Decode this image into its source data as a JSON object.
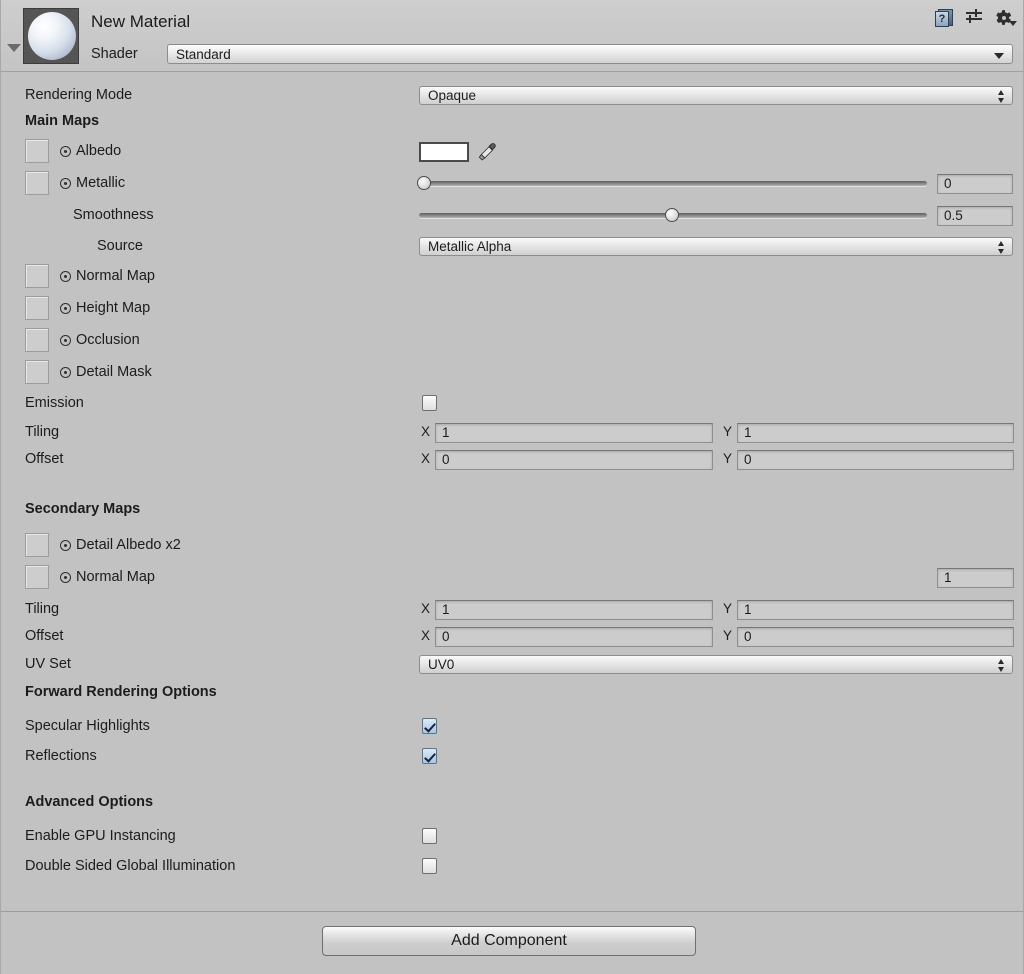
{
  "header": {
    "material_name": "New Material",
    "shader_label": "Shader",
    "shader_value": "Standard",
    "icons": {
      "help": "help-book-icon",
      "help_glyph": "?",
      "preset": "preset-sliders-icon",
      "settings": "gear-icon"
    }
  },
  "rendering_mode": {
    "label": "Rendering Mode",
    "value": "Opaque"
  },
  "main_maps": {
    "title": "Main Maps",
    "albedo": {
      "label": "Albedo",
      "color": "#ffffff"
    },
    "metallic": {
      "label": "Metallic",
      "value": "0",
      "slider": 0
    },
    "smoothness": {
      "label": "Smoothness",
      "value": "0.5",
      "slider": 0.5
    },
    "source": {
      "label": "Source",
      "value": "Metallic Alpha"
    },
    "normal_map": {
      "label": "Normal Map"
    },
    "height_map": {
      "label": "Height Map"
    },
    "occlusion": {
      "label": "Occlusion"
    },
    "detail_mask": {
      "label": "Detail Mask"
    },
    "emission": {
      "label": "Emission",
      "checked": false
    },
    "tiling": {
      "label": "Tiling",
      "x_letter": "X",
      "x": "1",
      "y_letter": "Y",
      "y": "1"
    },
    "offset": {
      "label": "Offset",
      "x_letter": "X",
      "x": "0",
      "y_letter": "Y",
      "y": "0"
    }
  },
  "secondary_maps": {
    "title": "Secondary Maps",
    "detail_albedo": {
      "label": "Detail Albedo x2"
    },
    "normal_map": {
      "label": "Normal Map",
      "value": "1"
    },
    "tiling": {
      "label": "Tiling",
      "x_letter": "X",
      "x": "1",
      "y_letter": "Y",
      "y": "1"
    },
    "offset": {
      "label": "Offset",
      "x_letter": "X",
      "x": "0",
      "y_letter": "Y",
      "y": "0"
    },
    "uv_set": {
      "label": "UV Set",
      "value": "UV0"
    }
  },
  "forward_rendering": {
    "title": "Forward Rendering Options",
    "specular_highlights": {
      "label": "Specular Highlights",
      "checked": true
    },
    "reflections": {
      "label": "Reflections",
      "checked": true
    }
  },
  "advanced_options": {
    "title": "Advanced Options",
    "gpu_instancing": {
      "label": "Enable GPU Instancing",
      "checked": false
    },
    "double_sided_gi": {
      "label": "Double Sided Global Illumination",
      "checked": false
    }
  },
  "footer": {
    "add_component": "Add Component"
  },
  "colors": {
    "background": "#c2c2c2",
    "text": "#1c1c1c",
    "checkbox_checked": "#a9c6e4",
    "slider_track": "#8f8f8f"
  }
}
